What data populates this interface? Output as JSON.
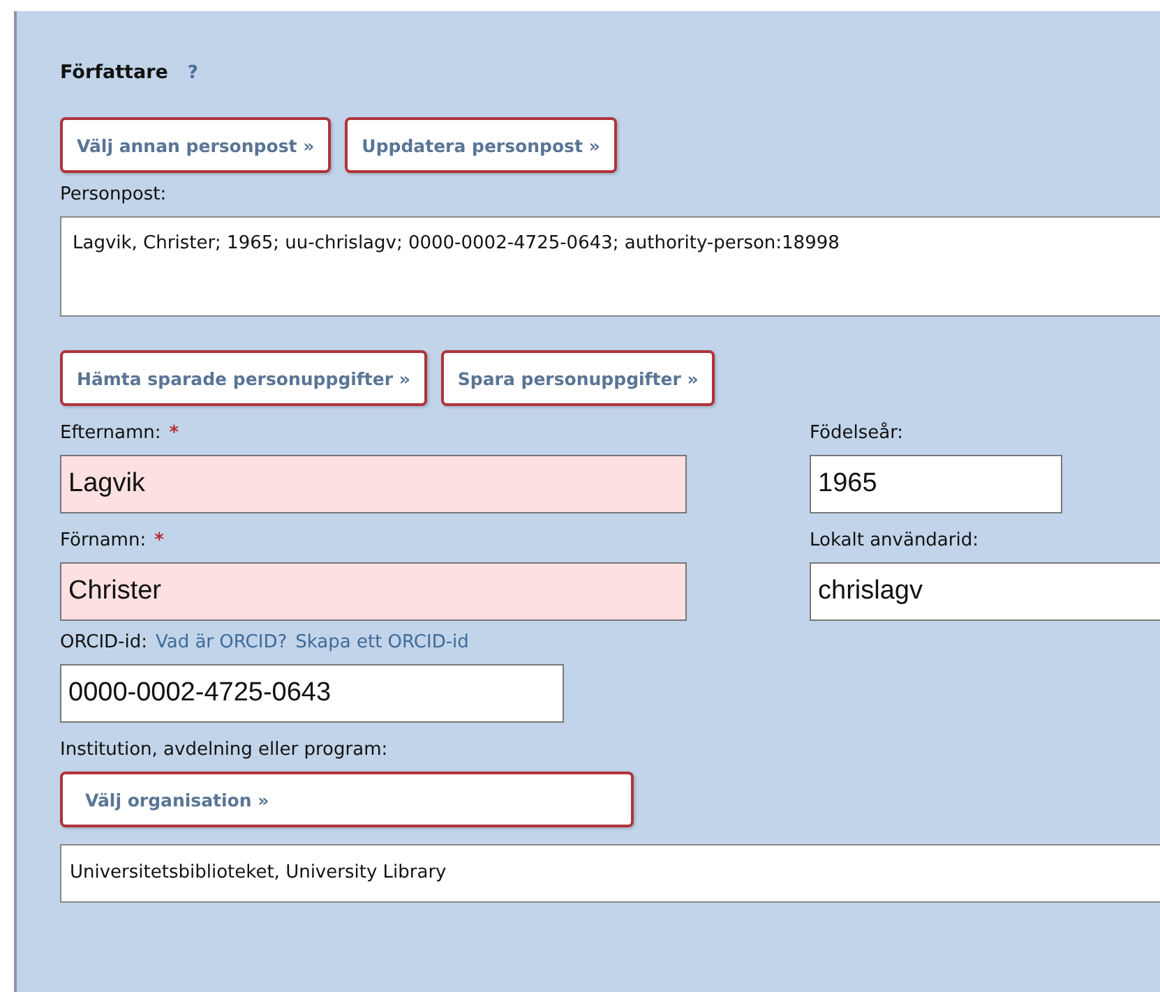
{
  "section": {
    "title": "Författare",
    "help": "?"
  },
  "record_buttons": [
    "Välj annan personpost »",
    "Uppdatera personpost »"
  ],
  "person_record": {
    "label": "Personpost:",
    "value": "Lagvik, Christer; 1965; uu-chrislagv; 0000-0002-4725-0643; authority-person:18998"
  },
  "saved_buttons": [
    "Hämta sparade personuppgifter »",
    "Spara personuppgifter »"
  ],
  "fields": [
    {
      "label": "Efternamn:",
      "required": true,
      "value": "Lagvik",
      "required_mark": "*"
    },
    {
      "label": "Födelseår:",
      "required": false,
      "value": "1965"
    },
    {
      "label": "Förnamn:",
      "required": true,
      "value": "Christer",
      "required_mark": "*"
    },
    {
      "label": "Lokalt användarid:",
      "required": false,
      "value": "chrislagv"
    }
  ],
  "orcid": {
    "label": "ORCID-id:",
    "links": [
      "Vad är ORCID?",
      "Skapa ett ORCID-id"
    ],
    "value": "0000-0002-4725-0643"
  },
  "organisation": {
    "label": "Institution, avdelning eller program:",
    "button": "Välj organisation »",
    "value": "Universitetsbiblioteket, University Library"
  }
}
